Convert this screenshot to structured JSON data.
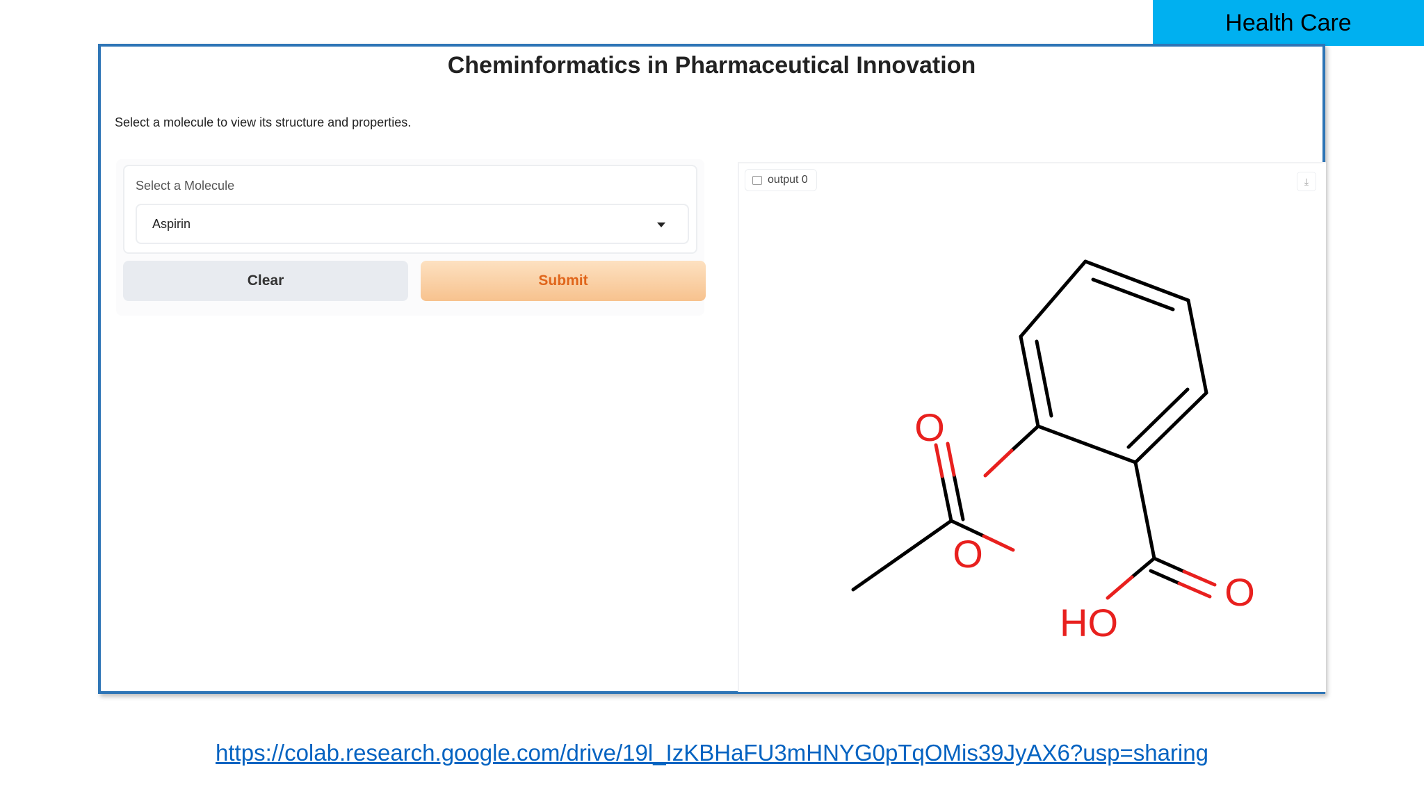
{
  "tag": {
    "label": "Health Care",
    "color": "#00b0f0"
  },
  "app": {
    "title": "Cheminformatics in Pharmaceutical Innovation",
    "description": "Select a molecule to view its structure and properties."
  },
  "input": {
    "label": "Select a Molecule",
    "selected": "Aspirin"
  },
  "buttons": {
    "clear": "Clear",
    "submit": "Submit"
  },
  "output": {
    "label": "output 0",
    "atoms": {
      "o_carbonyl": "O",
      "o_ester": "O",
      "o_acid": "O",
      "ho": "HO"
    }
  },
  "footer": {
    "link": "https://colab.research.google.com/drive/19l_IzKBHaFU3mHNYG0pTqOMis39JyAX6?usp=sharing"
  }
}
